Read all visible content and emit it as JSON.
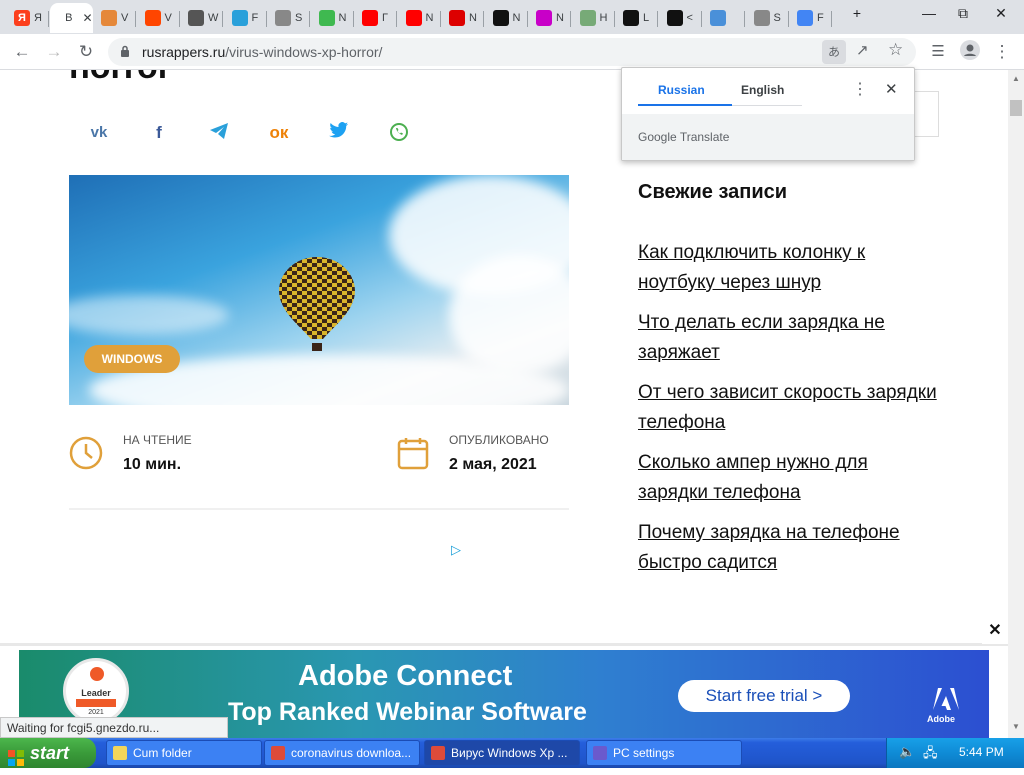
{
  "tabs": [
    {
      "fav": "Я",
      "label": "Я",
      "color": "#fc3f1d"
    },
    {
      "fav": "",
      "label": "В",
      "active": true
    },
    {
      "fav": "",
      "label": "V",
      "color": "#e5883a"
    },
    {
      "fav": "",
      "label": "V",
      "color": "#ff4500"
    },
    {
      "fav": "",
      "label": "W",
      "color": "#555"
    },
    {
      "fav": "",
      "label": "F",
      "color": "#2aa0da"
    },
    {
      "fav": "",
      "label": "S",
      "color": "#888"
    },
    {
      "fav": "",
      "label": "N",
      "color": "#3fb950"
    },
    {
      "fav": "",
      "label": "Г",
      "color": "#ff0000"
    },
    {
      "fav": "",
      "label": "N",
      "color": "#ff0000"
    },
    {
      "fav": "",
      "label": "N",
      "color": "#d00"
    },
    {
      "fav": "",
      "label": "N",
      "color": "#111"
    },
    {
      "fav": "",
      "label": "N",
      "color": "#c800c8"
    },
    {
      "fav": "",
      "label": "H",
      "color": "#7a7"
    },
    {
      "fav": "",
      "label": "L",
      "color": "#111"
    },
    {
      "fav": "",
      "label": "<",
      "color": "#111"
    },
    {
      "fav": "",
      "label": "",
      "color": "#4a90d9"
    },
    {
      "fav": "",
      "label": "S",
      "color": "#888"
    },
    {
      "fav": "",
      "label": "F",
      "color": "#4285f4"
    }
  ],
  "toolbar": {
    "url_host": "rusrappers.ru",
    "url_path": "/virus-windows-xp-horror/"
  },
  "article": {
    "title_fragment": "horror",
    "badge": "WINDOWS",
    "reading_label": "НА ЧТЕНИЕ",
    "reading_value": "10 мин.",
    "published_label": "ОПУБЛИКОВАНО",
    "published_value": "2 мая, 2021"
  },
  "sidebar": {
    "heading": "Свежие записи",
    "links": [
      "Как подключить колонку к ноутбуку через шнур",
      "Что делать если зарядка не заряжает",
      "От чего зависит скорость зарядки телефона",
      "Сколько ампер нужно для зарядки телефона",
      "Почему зарядка на телефоне быстро садится"
    ]
  },
  "translate": {
    "lang_from": "Russian",
    "lang_to": "English",
    "brand": "Google",
    "brand_suffix": "Translate"
  },
  "ad": {
    "title": "Adobe Connect",
    "subtitle": "Top Ranked Webinar Software",
    "cta": "Start free trial >",
    "badge_top": "Leader",
    "badge_year": "2021",
    "logo": "Adobe"
  },
  "status_text": "Waiting for fcgi5.gnezdo.ru...",
  "taskbar": {
    "start": "start",
    "tasks": [
      {
        "label": "Cum folder",
        "color": "#f3d55a"
      },
      {
        "label": "coronavirus downloa...",
        "color": "#dd4b39"
      },
      {
        "label": "Вирус Windows Xp ...",
        "color": "#dd4b39",
        "active": true
      },
      {
        "label": "PC settings",
        "color": "#6a5acd"
      }
    ],
    "clock": "5:44 PM"
  }
}
